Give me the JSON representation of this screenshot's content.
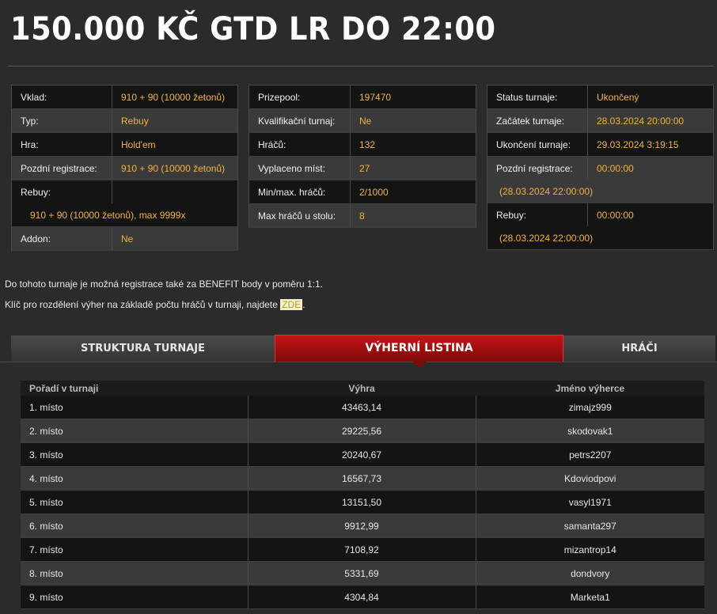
{
  "page": {
    "title": "150.000 KČ GTD LR DO 22:00"
  },
  "info1": [
    {
      "k": "Vklad:",
      "v": "910 + 90 (10000 žetonů)"
    },
    {
      "k": "Typ:",
      "v": "Rebuy"
    },
    {
      "k": "Hra:",
      "v": "Hold'em"
    },
    {
      "k": "Pozdní registrace:",
      "v": "910 + 90 (10000 žetonů)"
    },
    {
      "k": "Rebuy:",
      "v": "",
      "extra": "910 + 90 (10000 žetonů), max 9999x"
    },
    {
      "k": "Addon:",
      "v": "Ne"
    }
  ],
  "info2": [
    {
      "k": "Prizepool:",
      "v": "197470"
    },
    {
      "k": "Kvalifikační turnaj:",
      "v": "Ne"
    },
    {
      "k": "Hráčů:",
      "v": "132"
    },
    {
      "k": "Vyplaceno míst:",
      "v": "27"
    },
    {
      "k": "Min/max. hráčů:",
      "v": "2/1000"
    },
    {
      "k": "Max hráčů u stolu:",
      "v": "8"
    }
  ],
  "info3": [
    {
      "k": "Status turnaje:",
      "v": "Ukončený"
    },
    {
      "k": "Začátek turnaje:",
      "v": "28.03.2024 20:00:00"
    },
    {
      "k": "Ukončení turnaje:",
      "v": "29.03.2024 3:19:15"
    },
    {
      "k": "Pozdní registrace:",
      "v": "00:00:00",
      "extra": "(28.03.2024 22:00:00)"
    },
    {
      "k": "Rebuy:",
      "v": "00:00:00",
      "extra": "(28.03.2024 22:00:00)"
    }
  ],
  "notes": {
    "benefit": "Do tohoto turnaje je možná registrace také za BENEFIT body v poměru 1:1.",
    "key_text": "Klíč pro rozdělení výher na základě počtu hráčů v turnaji, najdete ",
    "key_link": "ZDE",
    "key_end": "."
  },
  "tabs": [
    {
      "label": "STRUKTURA TURNAJE",
      "active": false
    },
    {
      "label": "VÝHERNÍ LISTINA",
      "active": true
    },
    {
      "label": "HRÁČI",
      "active": false
    }
  ],
  "prizes": {
    "headers": [
      "Pořadí v turnaji",
      "Výhra",
      "Jméno výherce"
    ],
    "rows": [
      [
        "1. místo",
        "43463,14",
        "zimajz999"
      ],
      [
        "2. místo",
        "29225,56",
        "skodovak1"
      ],
      [
        "3. místo",
        "20240,67",
        "petrs2207"
      ],
      [
        "4. místo",
        "16567,73",
        "Kdoviodpovi"
      ],
      [
        "5. místo",
        "13151,50",
        "vasyl1971"
      ],
      [
        "6. místo",
        "9912,99",
        "samanta297"
      ],
      [
        "7. místo",
        "7108,92",
        "mizantrop14"
      ],
      [
        "8. místo",
        "5331,69",
        "dondvory"
      ],
      [
        "9. místo",
        "4304,84",
        "Marketa1"
      ]
    ]
  },
  "colors": {
    "accent": "#f0b43c",
    "tab_active": "#b01212",
    "background": "#2b2b2b"
  }
}
